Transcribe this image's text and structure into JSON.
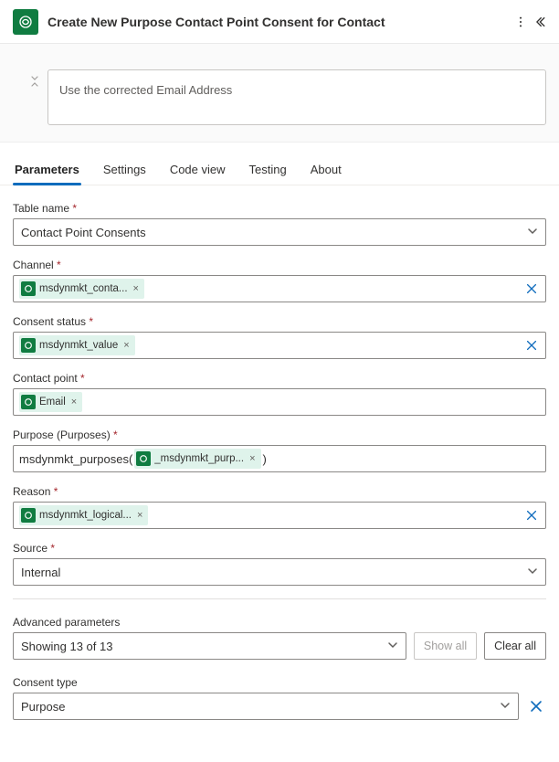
{
  "header": {
    "title": "Create New Purpose Contact Point Consent for Contact"
  },
  "card": {
    "text": "Use the corrected Email Address"
  },
  "tabs": {
    "parameters": "Parameters",
    "settings": "Settings",
    "codeview": "Code view",
    "testing": "Testing",
    "about": "About"
  },
  "fields": {
    "table_name": {
      "label": "Table name",
      "value": "Contact Point Consents"
    },
    "channel": {
      "label": "Channel",
      "token": "msdynmkt_conta..."
    },
    "consent_status": {
      "label": "Consent status",
      "token": "msdynmkt_value"
    },
    "contact_point": {
      "label": "Contact point",
      "token": "Email"
    },
    "purpose": {
      "label": "Purpose (Purposes)",
      "prefix": "msdynmkt_purposes(",
      "token": "_msdynmkt_purp...",
      "suffix": ")"
    },
    "reason": {
      "label": "Reason",
      "token": "msdynmkt_logical..."
    },
    "source": {
      "label": "Source",
      "value": "Internal"
    }
  },
  "advanced": {
    "label": "Advanced parameters",
    "summary": "Showing 13 of 13",
    "show_all": "Show all",
    "clear_all": "Clear all"
  },
  "consent_type": {
    "label": "Consent type",
    "value": "Purpose"
  }
}
